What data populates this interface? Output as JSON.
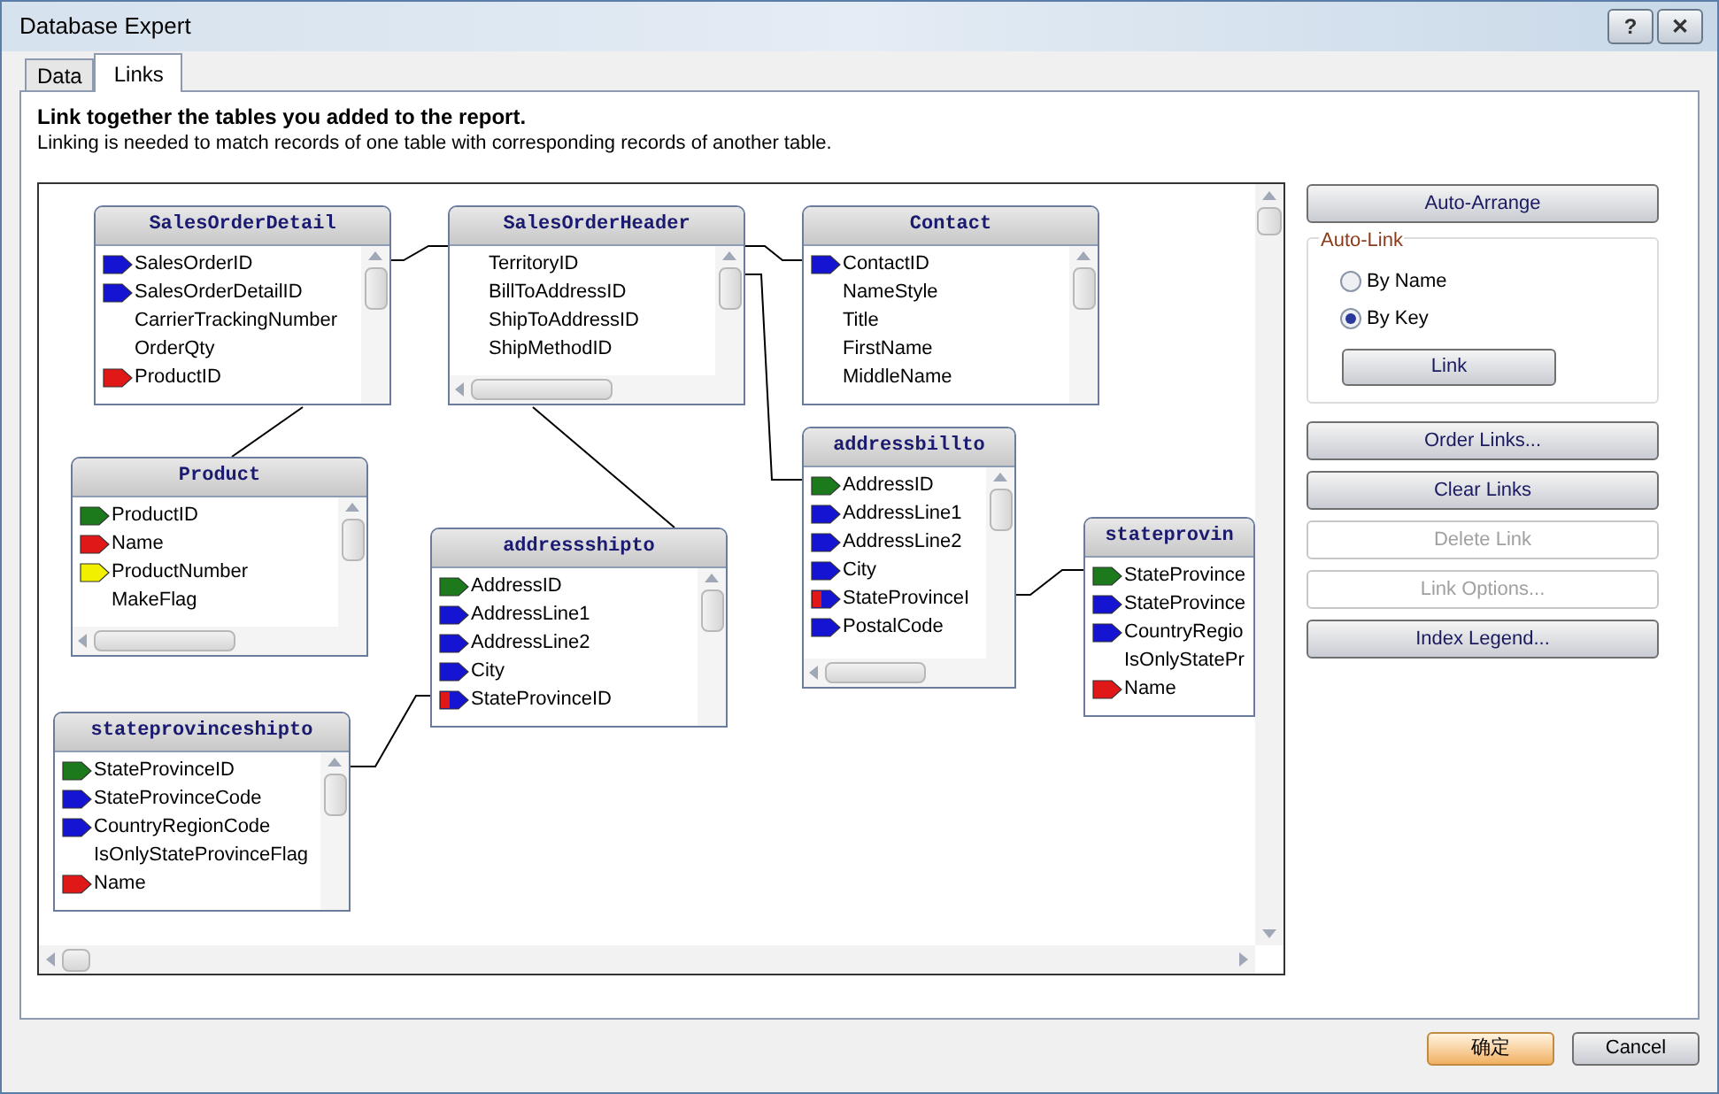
{
  "window": {
    "title": "Database Expert",
    "title_buttons": [
      "?",
      "✕"
    ]
  },
  "tabs": [
    {
      "label": "Data",
      "selected": false
    },
    {
      "label": "Links",
      "selected": true
    }
  ],
  "heading": "Link together the tables you added to the report.",
  "description": "Linking is needed to match records of one table with corresponding records of another table.",
  "tables": [
    {
      "name": "SalesOrderDetail",
      "kind": "plain",
      "fields": [
        {
          "name": "SalesOrderID",
          "color": "#1414d2"
        },
        {
          "name": "SalesOrderDetailID",
          "color": "#1414d2"
        },
        {
          "name": "CarrierTrackingNumber"
        },
        {
          "name": "OrderQty"
        },
        {
          "name": "ProductID",
          "color": "#e01818"
        }
      ]
    },
    {
      "name": "SalesOrderHeader",
      "kind": "scrolled",
      "fields": [
        {
          "name": "TerritoryID"
        },
        {
          "name": "BillToAddressID"
        },
        {
          "name": "ShipToAddressID"
        },
        {
          "name": "ShipMethodID"
        }
      ]
    },
    {
      "name": "Contact",
      "kind": "plain",
      "fields": [
        {
          "name": "ContactID",
          "color": "#1414d2"
        },
        {
          "name": "NameStyle"
        },
        {
          "name": "Title"
        },
        {
          "name": "FirstName"
        },
        {
          "name": "MiddleName"
        }
      ]
    },
    {
      "name": "Product",
      "kind": "scrolled",
      "fields": [
        {
          "name": "ProductID",
          "color": "#1c7a1c"
        },
        {
          "name": "Name",
          "color": "#e01818"
        },
        {
          "name": "ProductNumber",
          "color": "#f0f000"
        },
        {
          "name": "MakeFlag"
        }
      ]
    },
    {
      "name": "addressshipto",
      "kind": "plain",
      "fields": [
        {
          "name": "AddressID",
          "color": "#1c7a1c"
        },
        {
          "name": "AddressLine1",
          "color": "#1414d2"
        },
        {
          "name": "AddressLine2",
          "color": "#1414d2"
        },
        {
          "name": "City",
          "color": "#1414d2"
        },
        {
          "name": "StateProvinceID",
          "color": "#1414d2",
          "stripe": {
            "color": "#e01818"
          }
        }
      ]
    },
    {
      "name": "addressbillto",
      "kind": "scrolled",
      "fields": [
        {
          "name": "AddressID",
          "color": "#1c7a1c"
        },
        {
          "name": "AddressLine1",
          "color": "#1414d2"
        },
        {
          "name": "AddressLine2",
          "color": "#1414d2"
        },
        {
          "name": "City",
          "color": "#1414d2"
        },
        {
          "name": "StateProvinceI",
          "color": "#1414d2",
          "stripe": {
            "color": "#e01818"
          }
        },
        {
          "name": "PostalCode",
          "color": "#1414d2"
        }
      ]
    },
    {
      "name": "stateprovin",
      "kind": "cut",
      "fields": [
        {
          "name": "StateProvince",
          "color": "#1c7a1c"
        },
        {
          "name": "StateProvince",
          "color": "#1414d2"
        },
        {
          "name": "CountryRegio",
          "color": "#1414d2"
        },
        {
          "name": "IsOnlyStatePr"
        },
        {
          "name": "Name",
          "color": "#e01818"
        }
      ]
    },
    {
      "name": "stateprovinceshipto",
      "kind": "plain",
      "fields": [
        {
          "name": "StateProvinceID",
          "color": "#1c7a1c"
        },
        {
          "name": "StateProvinceCode",
          "color": "#1414d2"
        },
        {
          "name": "CountryRegionCode",
          "color": "#1414d2"
        },
        {
          "name": "IsOnlyStateProvinceFlag"
        },
        {
          "name": "Name",
          "color": "#e01818"
        }
      ]
    }
  ],
  "side_buttons_top": [
    {
      "label": "Auto-Arrange",
      "disabled": false
    }
  ],
  "auto_link": {
    "title": "Auto-Link",
    "options": [
      {
        "label": "By Name",
        "selected": false
      },
      {
        "label": "By Key",
        "selected": true
      }
    ],
    "button": "Link"
  },
  "side_buttons": [
    {
      "label": "Order Links...",
      "disabled": false
    },
    {
      "label": "Clear Links",
      "disabled": false
    },
    {
      "label": "Delete Link",
      "disabled": true
    },
    {
      "label": "Link Options...",
      "disabled": true
    },
    {
      "label": "Index Legend...",
      "disabled": false
    }
  ],
  "footer_buttons": [
    {
      "label": "确定",
      "kind": "default"
    },
    {
      "label": "Cancel",
      "kind": "normal"
    }
  ]
}
